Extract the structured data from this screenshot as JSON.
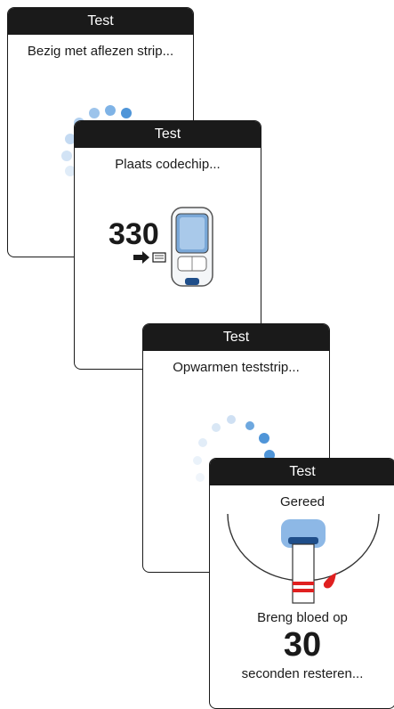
{
  "screens": [
    {
      "title": "Test",
      "message": "Bezig met aflezen strip..."
    },
    {
      "title": "Test",
      "message": "Plaats codechip...",
      "code": "330"
    },
    {
      "title": "Test",
      "message": "Opwarmen teststrip..."
    },
    {
      "title": "Test",
      "message": "Gereed",
      "instruction": "Breng bloed op",
      "countdown": "30",
      "countdown_label": "seconden resteren..."
    }
  ],
  "colors": {
    "titlebar": "#1a1a1a",
    "spinner_dark": "#4f95d8",
    "spinner_light": "#dbe9f6",
    "strip_red": "#e02020"
  }
}
